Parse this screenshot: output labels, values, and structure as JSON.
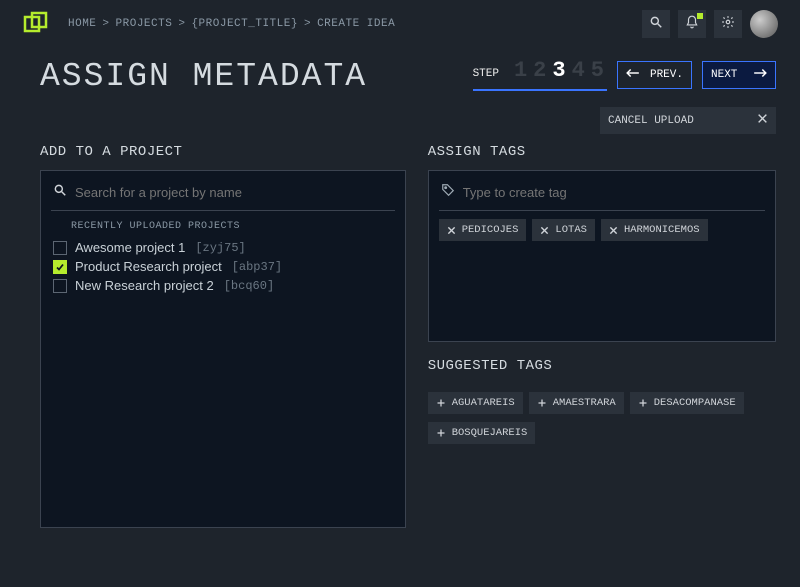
{
  "breadcrumb": [
    "HOME",
    "PROJECTS",
    "{PROJECT_TITLE}",
    "CREATE IDEA"
  ],
  "page_title": "ASSIGN METADATA",
  "stepper": {
    "label": "STEP",
    "steps": [
      "1",
      "2",
      "3",
      "4",
      "5"
    ],
    "current": 3,
    "prev_label": "PREV.",
    "next_label": "NEXT"
  },
  "cancel_upload_label": "CANCEL UPLOAD",
  "left": {
    "heading": "ADD TO A PROJECT",
    "search_placeholder": "Search for a project by name",
    "recent_heading": "RECENTLY UPLOADED PROJECTS",
    "projects": [
      {
        "name": "Awesome project 1",
        "code": "[zyj75]",
        "checked": false
      },
      {
        "name": "Product Research project",
        "code": "[abp37]",
        "checked": true
      },
      {
        "name": "New Research project 2",
        "code": "[bcq60]",
        "checked": false
      }
    ]
  },
  "right": {
    "heading": "ASSIGN TAGS",
    "tag_input_placeholder": "Type to create tag",
    "tags": [
      "PEDICOJES",
      "LOTAS",
      "HARMONICEMOS"
    ],
    "suggested_heading": "SUGGESTED TAGS",
    "suggested": [
      "AGUATAREIS",
      "AMAESTRARA",
      "DESACOMPANASE",
      "BOSQUEJAREIS"
    ]
  }
}
